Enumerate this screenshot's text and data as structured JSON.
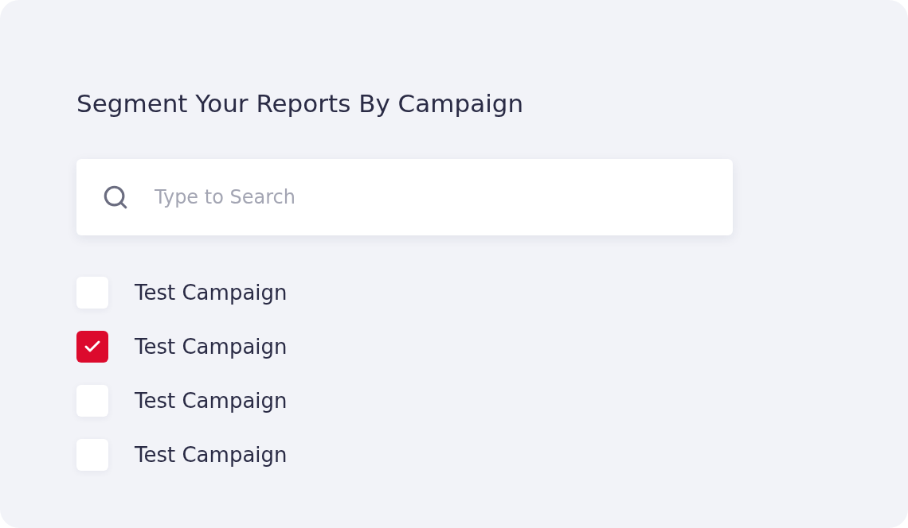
{
  "title": "Segment Your Reports By Campaign",
  "search": {
    "placeholder": "Type to Search"
  },
  "campaigns": [
    {
      "label": "Test Campaign",
      "checked": false
    },
    {
      "label": "Test Campaign",
      "checked": true
    },
    {
      "label": "Test Campaign",
      "checked": false
    },
    {
      "label": "Test Campaign",
      "checked": false
    }
  ]
}
